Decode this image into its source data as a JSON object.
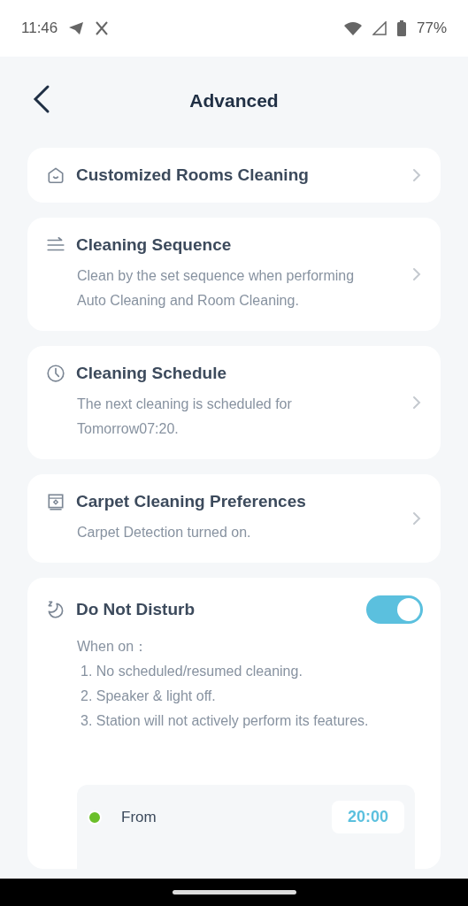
{
  "status_bar": {
    "time": "11:46",
    "battery": "77%"
  },
  "header": {
    "title": "Advanced"
  },
  "items": [
    {
      "kind": "link",
      "title": "Customized Rooms Cleaning"
    },
    {
      "kind": "link",
      "title": "Cleaning Sequence",
      "description": "Clean by the set sequence when performing Auto Cleaning and Room Cleaning."
    },
    {
      "kind": "link",
      "title": "Cleaning Schedule",
      "description": "The next cleaning is scheduled for Tomorrow07:20."
    },
    {
      "kind": "link",
      "title": "Carpet Cleaning Preferences",
      "description": "Carpet Detection turned on."
    },
    {
      "kind": "toggle",
      "title": "Do Not Disturb",
      "on": true,
      "note_heading": "When on：",
      "note_lines": [
        "1. No scheduled/resumed cleaning.",
        "2. Speaker & light off.",
        "3. Station will not actively perform its features."
      ],
      "times": [
        {
          "label": "From",
          "value": "20:00",
          "color": "#6bbf2a"
        }
      ]
    }
  ]
}
